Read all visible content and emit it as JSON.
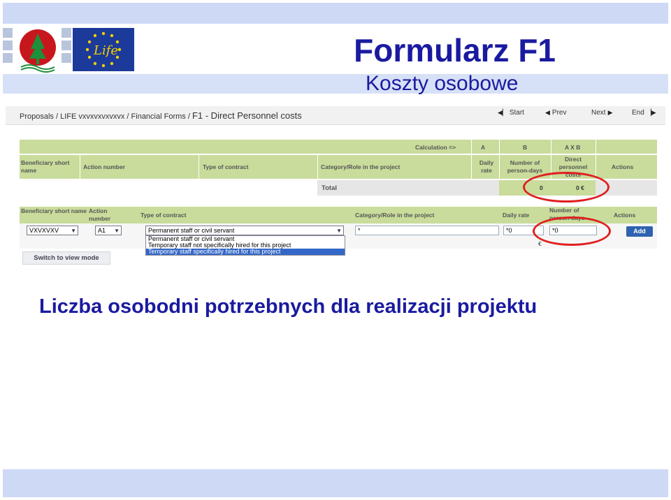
{
  "slide": {
    "title": "Formularz F1",
    "subtitle": "Koszty osobowe",
    "caption": "Liczba osobodni potrzebnych dla realizacji projektu",
    "title_color": "#1a1aa0"
  },
  "breadcrumb": {
    "part1": "Proposals / LIFE vxvxvxvxvxvx / Financial Forms / ",
    "part2": "F1 - Direct Personnel costs"
  },
  "pager": {
    "start": "Start",
    "prev": "Prev",
    "next": "Next",
    "end": "End"
  },
  "summary_table": {
    "calc_label": "Calculation =>",
    "calc_a": "A",
    "calc_b": "B",
    "calc_axb": "A X B",
    "headers": [
      "Beneficiary short name",
      "Action number",
      "Type of contract",
      "Category/Role in the project",
      "Daily rate",
      "Number of person-days",
      "Direct personnel costs",
      "Actions"
    ],
    "total_label": "Total",
    "total_days": "0",
    "total_costs": "0 €"
  },
  "input_table": {
    "headers": [
      "Beneficiary short name",
      "Action number",
      "Type of contract",
      "Category/Role in the project",
      "Daily rate",
      "Number of person-days",
      "Actions"
    ],
    "beneficiary_value": "VXVXVXV",
    "action_value": "A1",
    "contract_value": "Permanent staff or civil servant",
    "contract_options": [
      "Permanent staff or civil servant",
      "Temporary staff not specifically hired for this project",
      "Temporary staff specifically hired for this project"
    ],
    "role_value": "*",
    "daily_rate_value": "*0",
    "person_days_value": "*0",
    "euro": "€",
    "add_label": "Add",
    "switch_label": "Switch to view mode"
  },
  "colors": {
    "header_green": "#c9dc9b",
    "highlight": "#e02020",
    "band": "#cdd9f5"
  }
}
